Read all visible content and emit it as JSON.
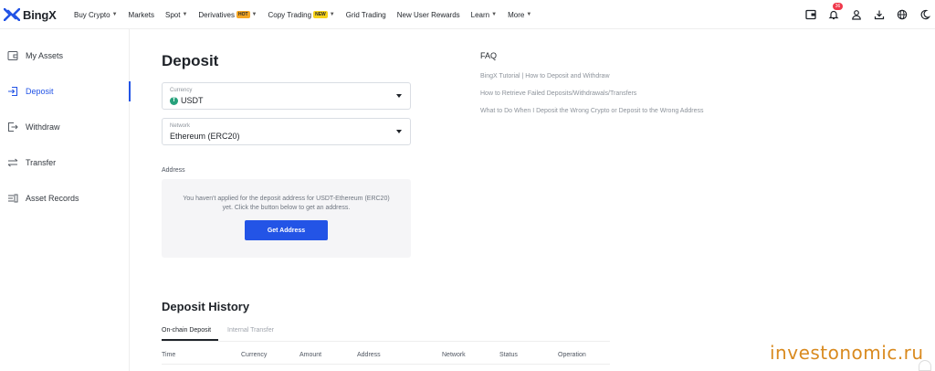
{
  "brand": {
    "name": "BingX"
  },
  "nav": {
    "items": [
      {
        "label": "Buy Crypto",
        "dropdown": true
      },
      {
        "label": "Markets",
        "dropdown": false
      },
      {
        "label": "Spot",
        "dropdown": true
      },
      {
        "label": "Derivatives",
        "dropdown": true,
        "tag": "HOT"
      },
      {
        "label": "Copy Trading",
        "dropdown": true,
        "tag": "NEW"
      },
      {
        "label": "Grid Trading",
        "dropdown": false
      },
      {
        "label": "New User Rewards",
        "dropdown": false
      },
      {
        "label": "Learn",
        "dropdown": true
      },
      {
        "label": "More",
        "dropdown": true
      }
    ],
    "notification_count": "36",
    "icons": [
      "wallet-icon",
      "bell-icon",
      "user-icon",
      "download-icon",
      "globe-icon",
      "moon-icon"
    ]
  },
  "sidebar": {
    "items": [
      {
        "label": "My Assets",
        "icon": "wallet-icon"
      },
      {
        "label": "Deposit",
        "icon": "deposit-icon",
        "active": true
      },
      {
        "label": "Withdraw",
        "icon": "withdraw-icon"
      },
      {
        "label": "Transfer",
        "icon": "transfer-icon"
      },
      {
        "label": "Asset Records",
        "icon": "records-icon"
      }
    ]
  },
  "deposit": {
    "title": "Deposit",
    "currency": {
      "label": "Currency",
      "value": "USDT",
      "coin_glyph": "T"
    },
    "network": {
      "label": "Network",
      "value": "Ethereum (ERC20)"
    },
    "address_label": "Address",
    "address_message": "You haven't applied for the deposit address for USDT-Ethereum (ERC20) yet. Click the button below to get an address.",
    "get_address_button": "Get Address"
  },
  "faq": {
    "title": "FAQ",
    "links": [
      "BingX Tutorial | How to Deposit and Withdraw",
      "How to Retrieve Failed Deposits/Withdrawals/Transfers",
      "What to Do When I Deposit the Wrong Crypto or Deposit to the Wrong Address"
    ]
  },
  "history": {
    "title": "Deposit History",
    "tabs": [
      {
        "label": "On-chain Deposit",
        "active": true
      },
      {
        "label": "Internal Transfer",
        "active": false
      }
    ],
    "columns": [
      "Time",
      "Currency",
      "Amount",
      "Address",
      "Network",
      "Status",
      "Operation"
    ]
  },
  "watermark": "investonomic.ru",
  "colors": {
    "accent": "#2354e6",
    "tether": "#26a17b",
    "badge": "#f0384b",
    "watermark": "#d98a1f"
  }
}
